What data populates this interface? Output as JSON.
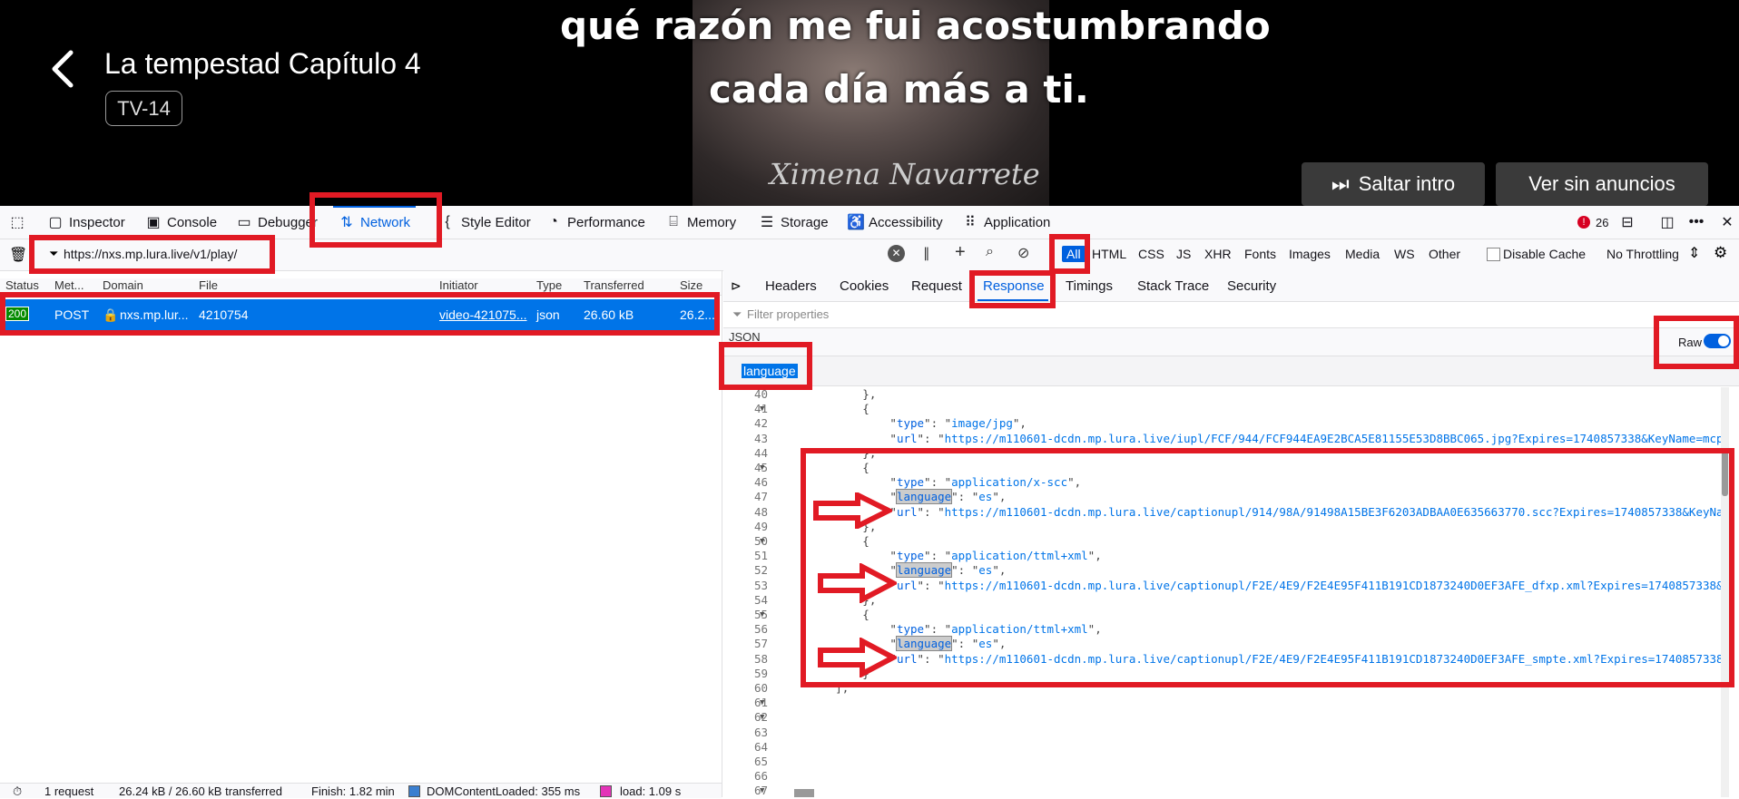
{
  "video": {
    "subtitle_line1": "qué razón me fui acostumbrando",
    "subtitle_line2": "cada día más a ti.",
    "signature": "Ximena Navarrete",
    "title": "La tempestad Capítulo 4",
    "rating": "TV-14",
    "skip_intro": "Saltar intro",
    "no_ads": "Ver sin anuncios"
  },
  "toolbar": {
    "inspector": "Inspector",
    "console": "Console",
    "debugger": "Debugger",
    "network": "Network",
    "style_editor": "Style Editor",
    "performance": "Performance",
    "memory": "Memory",
    "storage": "Storage",
    "accessibility": "Accessibility",
    "application": "Application",
    "error_count": "26"
  },
  "filter": {
    "url": "https://nxs.mp.lura.live/v1/play/",
    "types": [
      "All",
      "HTML",
      "CSS",
      "JS",
      "XHR",
      "Fonts",
      "Images",
      "Media",
      "WS",
      "Other"
    ],
    "disable_cache": "Disable Cache",
    "throttling": "No Throttling"
  },
  "request_table": {
    "headers": [
      "Status",
      "Met...",
      "Domain",
      "File",
      "Initiator",
      "Type",
      "Transferred",
      "Size"
    ],
    "row": {
      "status": "200",
      "method": "POST",
      "domain": "nxs.mp.lur...",
      "file": "4210754",
      "initiator": "video-421075...",
      "type": "json",
      "transferred": "26.60 kB",
      "size": "26.2..."
    }
  },
  "detail_tabs": [
    "Headers",
    "Cookies",
    "Request",
    "Response",
    "Timings",
    "Stack Trace",
    "Security"
  ],
  "response": {
    "filter_placeholder": "Filter properties",
    "json_label": "JSON",
    "raw_label": "Raw",
    "search_term": "language"
  },
  "code_lines": [
    {
      "n": "40",
      "t": "            },"
    },
    {
      "n": "41",
      "t": "            {",
      "fold": true
    },
    {
      "n": "42",
      "t": "                \"type\": \"image/jpg\","
    },
    {
      "n": "43",
      "t": "                \"url\": \"https://m110601-dcdn.mp.lura.live/iupl/FCF/944/FCF944EA9E2BCA5E81155E53D8BBC065.jpg?Expires=1740857338&KeyName=mcp"
    },
    {
      "n": "44",
      "t": "            },"
    },
    {
      "n": "45",
      "t": "            {",
      "fold": true
    },
    {
      "n": "46",
      "t": "                \"type\": \"application/x-scc\","
    },
    {
      "n": "47",
      "t": "                \"language\": \"es\","
    },
    {
      "n": "48",
      "t": "                \"url\": \"https://m110601-dcdn.mp.lura.live/captionupl/914/98A/91498A15BE3F6203ADBAA0E635663770.scc?Expires=1740857338&KeyNa"
    },
    {
      "n": "49",
      "t": "            },"
    },
    {
      "n": "50",
      "t": "            {",
      "fold": true
    },
    {
      "n": "51",
      "t": "                \"type\": \"application/ttml+xml\","
    },
    {
      "n": "52",
      "t": "                \"language\": \"es\","
    },
    {
      "n": "53",
      "t": "                \"url\": \"https://m110601-dcdn.mp.lura.live/captionupl/F2E/4E9/F2E4E95F411B191CD1873240D0EF3AFE_dfxp.xml?Expires=1740857338&"
    },
    {
      "n": "54",
      "t": "            },"
    },
    {
      "n": "55",
      "t": "            {",
      "fold": true
    },
    {
      "n": "56",
      "t": "                \"type\": \"application/ttml+xml\","
    },
    {
      "n": "57",
      "t": "                \"language\": \"es\","
    },
    {
      "n": "58",
      "t": "                \"url\": \"https://m110601-dcdn.mp.lura.live/captionupl/F2E/4E9/F2E4E95F411B191CD1873240D0EF3AFE_smpte.xml?Expires=1740857338"
    },
    {
      "n": "59",
      "t": "            }"
    },
    {
      "n": "60",
      "t": "        ],"
    },
    {
      "n": "61",
      "t": "",
      "fold": true
    },
    {
      "n": "62",
      "t": "",
      "fold": true
    },
    {
      "n": "63",
      "t": ""
    },
    {
      "n": "64",
      "t": ""
    },
    {
      "n": "65",
      "t": ""
    },
    {
      "n": "66",
      "t": ""
    },
    {
      "n": "67",
      "t": "",
      "fold": true
    }
  ],
  "status_bar": {
    "requests": "1 request",
    "size": "26.24 kB / 26.60 kB transferred",
    "finish": "Finish: 1.82 min",
    "dom": "DOMContentLoaded: 355 ms",
    "load": "load: 1.09 s"
  },
  "colors": {
    "selection": "#0074e8",
    "annotation_red": "#e11a24",
    "active_tab": "#0060df"
  }
}
